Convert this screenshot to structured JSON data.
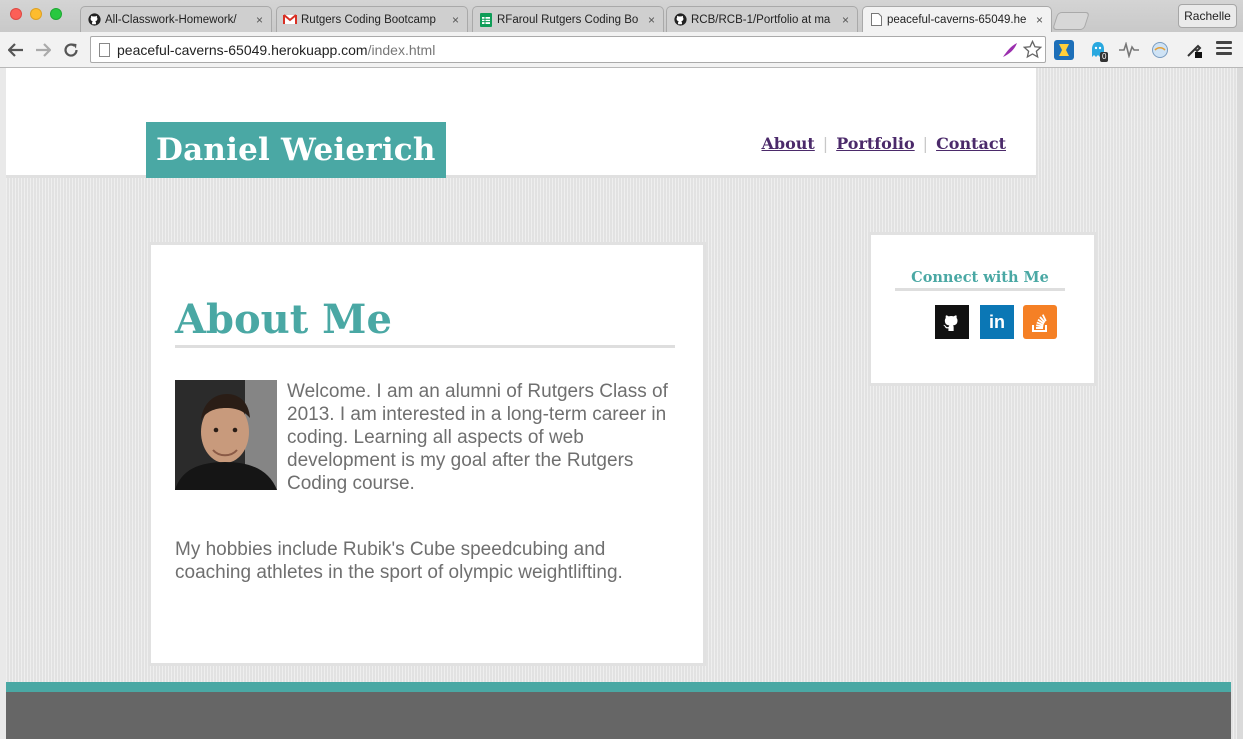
{
  "browser": {
    "tabs": [
      {
        "label": "All-Classwork-Homework/",
        "icon": "github-icon"
      },
      {
        "label": "Rutgers Coding Bootcamp",
        "icon": "gmail-icon"
      },
      {
        "label": "RFaroul Rutgers Coding Bo",
        "icon": "sheets-icon"
      },
      {
        "label": "RCB/RCB-1/Portfolio at ma",
        "icon": "github-icon"
      },
      {
        "label": "peaceful-caverns-65049.he",
        "icon": "page-icon"
      }
    ],
    "tab_close_glyph": "×",
    "profile_name": "Rachelle",
    "url_host": "peaceful-caverns-65049.herokuapp.com",
    "url_path": "/index.html",
    "extension_badge": "0"
  },
  "site": {
    "brand": "Daniel Weierich",
    "nav": {
      "about": "About",
      "portfolio": "Portfolio",
      "contact": "Contact",
      "separator": "|"
    },
    "about_title": "About Me",
    "intro": "Welcome. I am an alumni of Rutgers Class of 2013. I am interested in a long-term career in coding. Learning all aspects of web development is my goal after the Rutgers Coding course.",
    "hobbies": "My hobbies include Rubik's Cube speedcubing and coaching athletes in the sport of olympic weightlifting.",
    "connect_title": "Connect with Me",
    "linkedin_glyph": "in"
  },
  "colors": {
    "accent": "#4aa8a4",
    "nav_link": "#4b2a6a",
    "body_text": "#6f6f6f",
    "footer": "#666666",
    "linkedin": "#0b77b5",
    "stackoverflow": "#f58025"
  }
}
